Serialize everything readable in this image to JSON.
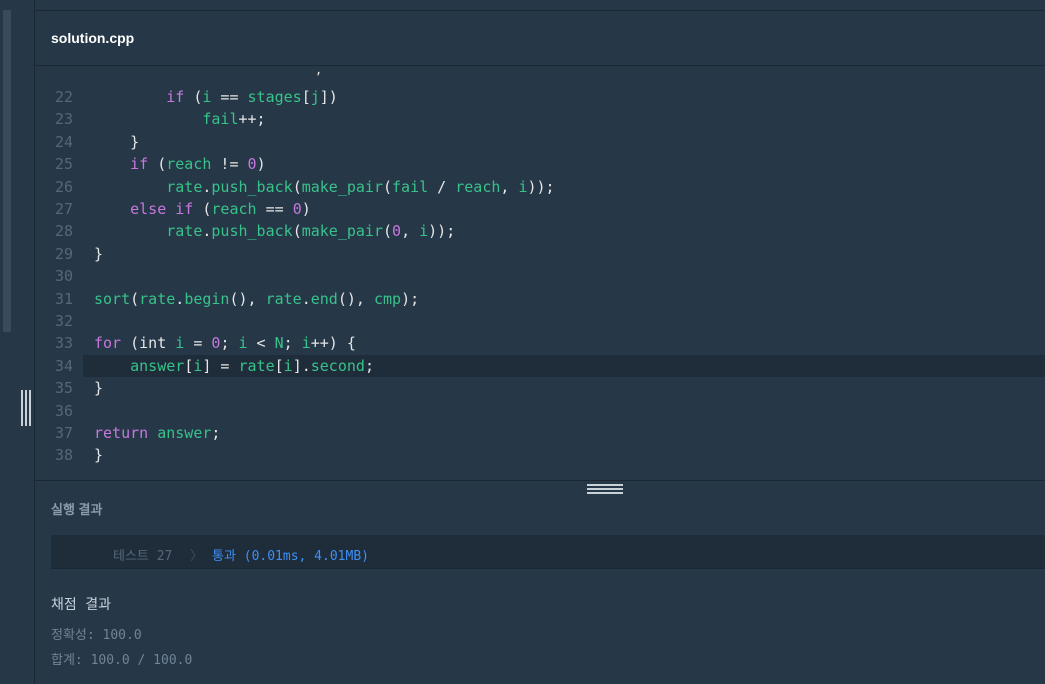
{
  "file_tab": {
    "name": "solution.cpp"
  },
  "editor": {
    "lines": [
      {
        "num": "22",
        "code": [
          [
            "pl",
            "        "
          ],
          [
            "kw",
            "if"
          ],
          [
            "pl",
            " ("
          ],
          [
            "id",
            "i"
          ],
          [
            "pl",
            " == "
          ],
          [
            "id",
            "stages"
          ],
          [
            "pl",
            "["
          ],
          [
            "id",
            "j"
          ],
          [
            "pl",
            "])"
          ]
        ]
      },
      {
        "num": "23",
        "code": [
          [
            "pl",
            "            "
          ],
          [
            "id",
            "fail"
          ],
          [
            "pl",
            "++;"
          ]
        ]
      },
      {
        "num": "24",
        "code": [
          [
            "pl",
            "    }"
          ]
        ]
      },
      {
        "num": "25",
        "code": [
          [
            "pl",
            "    "
          ],
          [
            "kw",
            "if"
          ],
          [
            "pl",
            " ("
          ],
          [
            "id",
            "reach"
          ],
          [
            "pl",
            " != "
          ],
          [
            "num",
            "0"
          ],
          [
            "pl",
            ")"
          ]
        ]
      },
      {
        "num": "26",
        "code": [
          [
            "pl",
            "        "
          ],
          [
            "id",
            "rate"
          ],
          [
            "pl",
            "."
          ],
          [
            "fn",
            "push_back"
          ],
          [
            "pl",
            "("
          ],
          [
            "fn",
            "make_pair"
          ],
          [
            "pl",
            "("
          ],
          [
            "id",
            "fail"
          ],
          [
            "pl",
            " / "
          ],
          [
            "id",
            "reach"
          ],
          [
            "pl",
            ", "
          ],
          [
            "id",
            "i"
          ],
          [
            "pl",
            "));"
          ]
        ]
      },
      {
        "num": "27",
        "code": [
          [
            "pl",
            "    "
          ],
          [
            "kw",
            "else if"
          ],
          [
            "pl",
            " ("
          ],
          [
            "id",
            "reach"
          ],
          [
            "pl",
            " == "
          ],
          [
            "num",
            "0"
          ],
          [
            "pl",
            ")"
          ]
        ]
      },
      {
        "num": "28",
        "code": [
          [
            "pl",
            "        "
          ],
          [
            "id",
            "rate"
          ],
          [
            "pl",
            "."
          ],
          [
            "fn",
            "push_back"
          ],
          [
            "pl",
            "("
          ],
          [
            "fn",
            "make_pair"
          ],
          [
            "pl",
            "("
          ],
          [
            "num",
            "0"
          ],
          [
            "pl",
            ", "
          ],
          [
            "id",
            "i"
          ],
          [
            "pl",
            "));"
          ]
        ]
      },
      {
        "num": "29",
        "code": [
          [
            "pl",
            "}"
          ]
        ]
      },
      {
        "num": "30",
        "code": []
      },
      {
        "num": "31",
        "code": [
          [
            "fn",
            "sort"
          ],
          [
            "pl",
            "("
          ],
          [
            "id",
            "rate"
          ],
          [
            "pl",
            "."
          ],
          [
            "fn",
            "begin"
          ],
          [
            "pl",
            "(), "
          ],
          [
            "id",
            "rate"
          ],
          [
            "pl",
            "."
          ],
          [
            "fn",
            "end"
          ],
          [
            "pl",
            "(), "
          ],
          [
            "id",
            "cmp"
          ],
          [
            "pl",
            ");"
          ]
        ]
      },
      {
        "num": "32",
        "code": []
      },
      {
        "num": "33",
        "code": [
          [
            "kw",
            "for"
          ],
          [
            "pl",
            " (int "
          ],
          [
            "id",
            "i"
          ],
          [
            "pl",
            " = "
          ],
          [
            "num",
            "0"
          ],
          [
            "pl",
            "; "
          ],
          [
            "id",
            "i"
          ],
          [
            "pl",
            " < "
          ],
          [
            "id",
            "N"
          ],
          [
            "pl",
            "; "
          ],
          [
            "id",
            "i"
          ],
          [
            "pl",
            "++) {"
          ]
        ]
      },
      {
        "num": "34",
        "code": [
          [
            "pl",
            "    "
          ],
          [
            "id",
            "answer"
          ],
          [
            "pl",
            "["
          ],
          [
            "id",
            "i"
          ],
          [
            "pl",
            "] = "
          ],
          [
            "id",
            "rate"
          ],
          [
            "pl",
            "["
          ],
          [
            "id",
            "i"
          ],
          [
            "pl",
            "]."
          ],
          [
            "id",
            "second"
          ],
          [
            "pl",
            ";"
          ]
        ]
      },
      {
        "num": "35",
        "code": [
          [
            "pl",
            "}"
          ]
        ]
      },
      {
        "num": "36",
        "code": []
      },
      {
        "num": "37",
        "code": [
          [
            "kw",
            "return"
          ],
          [
            "pl",
            " "
          ],
          [
            "id",
            "answer"
          ],
          [
            "pl",
            ";"
          ]
        ]
      },
      {
        "num": "38",
        "code": [
          [
            "pl",
            "}"
          ]
        ]
      }
    ]
  },
  "results": {
    "title": "실행 결과",
    "test": {
      "label": "테스트 27",
      "separator": "〉",
      "result": "통과 (0.01ms, 4.01MB)"
    }
  },
  "grading": {
    "title": "채점 결과",
    "accuracy": "정확성: 100.0",
    "total": "합계: 100.0 / 100.0"
  }
}
